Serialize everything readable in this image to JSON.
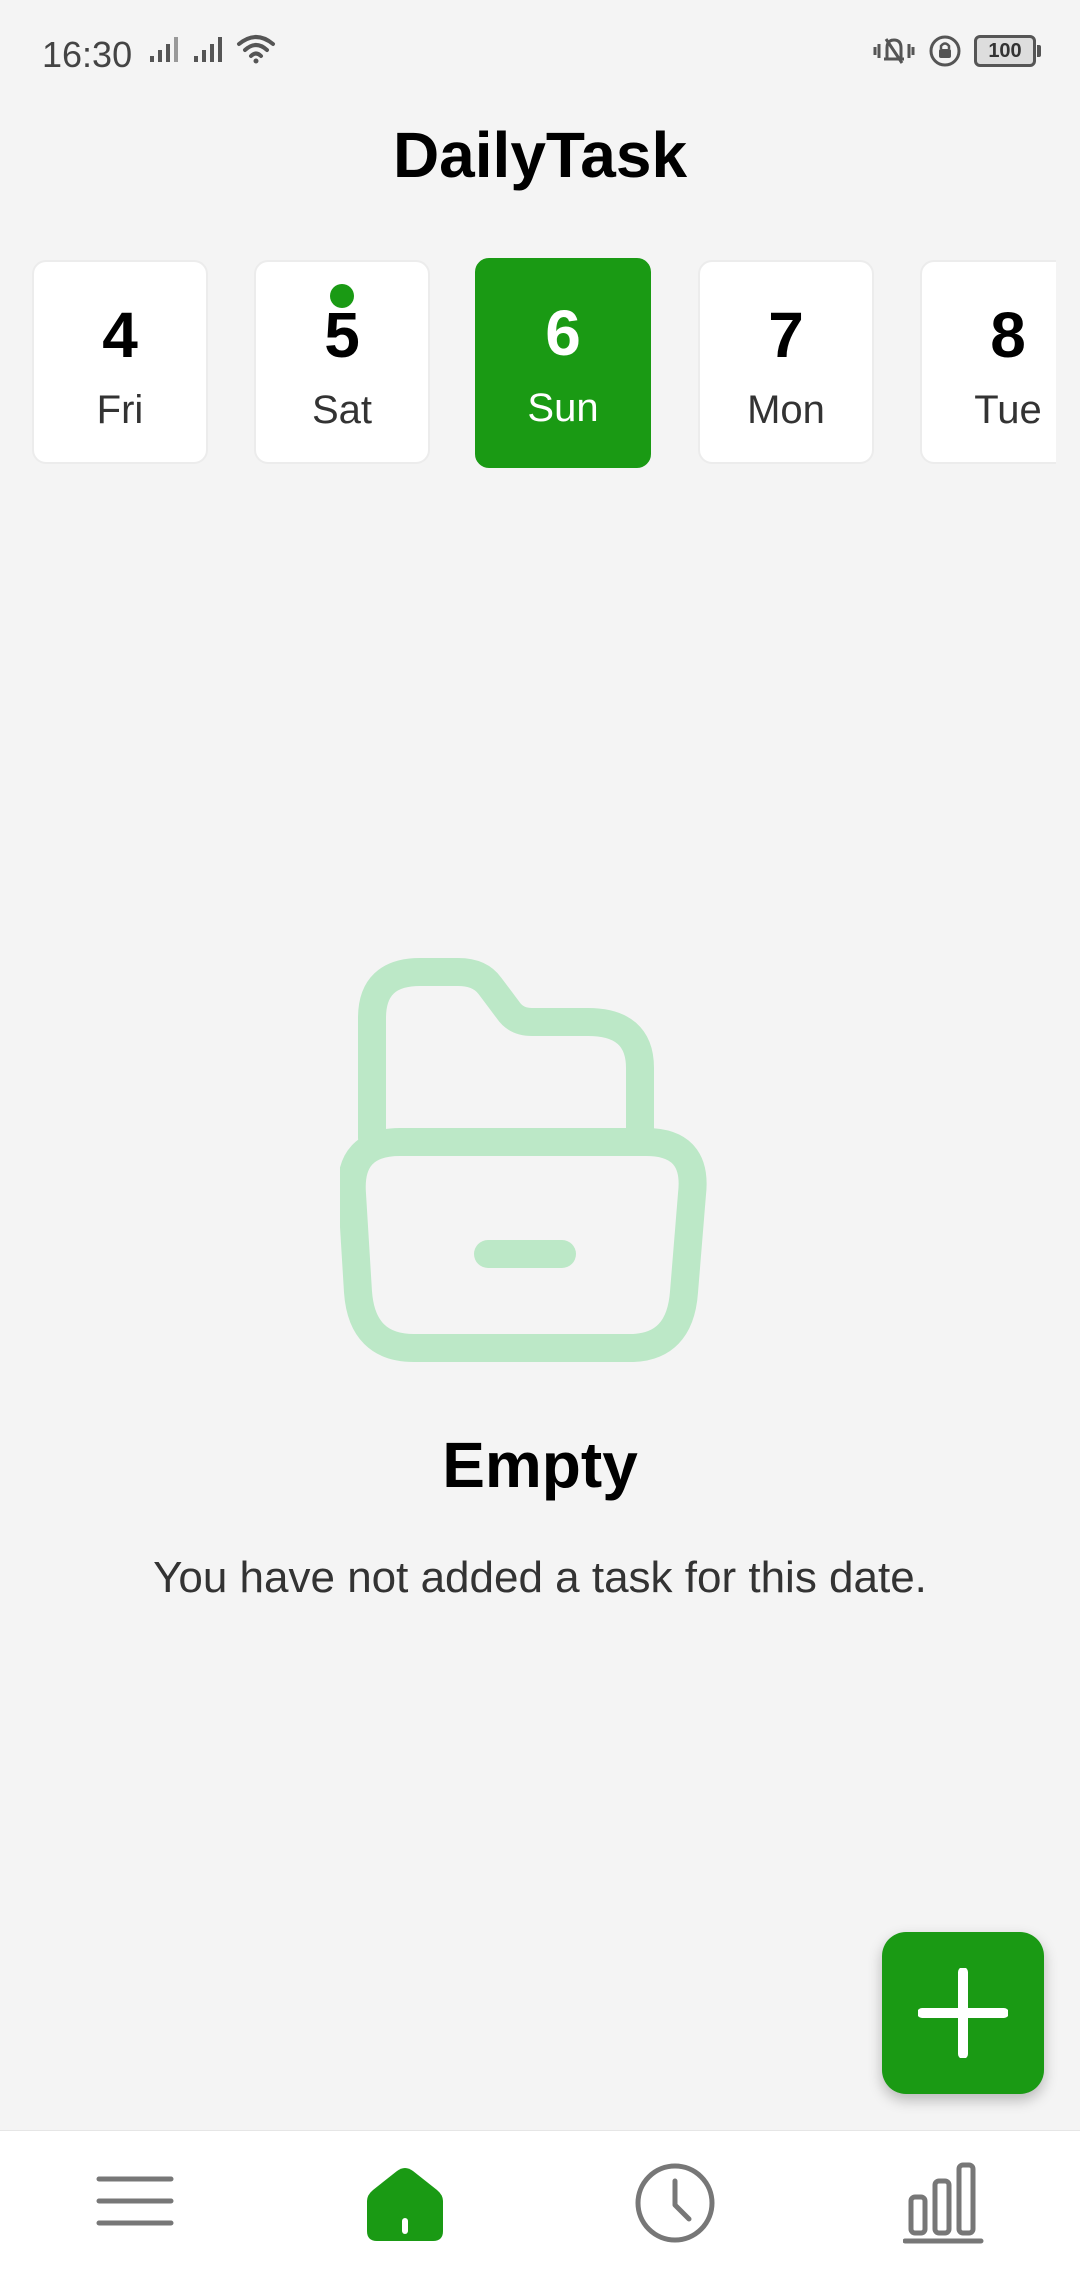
{
  "status_bar": {
    "time": "16:30",
    "battery_level": "100",
    "left_icons": [
      "signal-icon",
      "signal-icon",
      "wifi-icon"
    ],
    "right_icons": [
      "vibrate-icon",
      "rotation-lock-icon",
      "battery-icon"
    ]
  },
  "app": {
    "title": "DailyTask",
    "accent_color": "#1a9a14"
  },
  "date_strip": {
    "selected_index": 2,
    "dates": [
      {
        "num": "4",
        "day": "Fri",
        "has_task": false
      },
      {
        "num": "5",
        "day": "Sat",
        "has_task": true
      },
      {
        "num": "6",
        "day": "Sun",
        "has_task": false
      },
      {
        "num": "7",
        "day": "Mon",
        "has_task": false
      },
      {
        "num": "8",
        "day": "Tue",
        "has_task": false
      }
    ]
  },
  "empty_state": {
    "icon": "folder-open-icon",
    "title": "Empty",
    "message": "You have not added a task for this date."
  },
  "fab": {
    "icon": "plus-icon"
  },
  "bottom_nav": {
    "active": "home",
    "items": [
      {
        "id": "menu",
        "icon": "menu-icon"
      },
      {
        "id": "home",
        "icon": "home-icon"
      },
      {
        "id": "history",
        "icon": "clock-icon"
      },
      {
        "id": "stats",
        "icon": "bar-chart-icon"
      }
    ]
  }
}
